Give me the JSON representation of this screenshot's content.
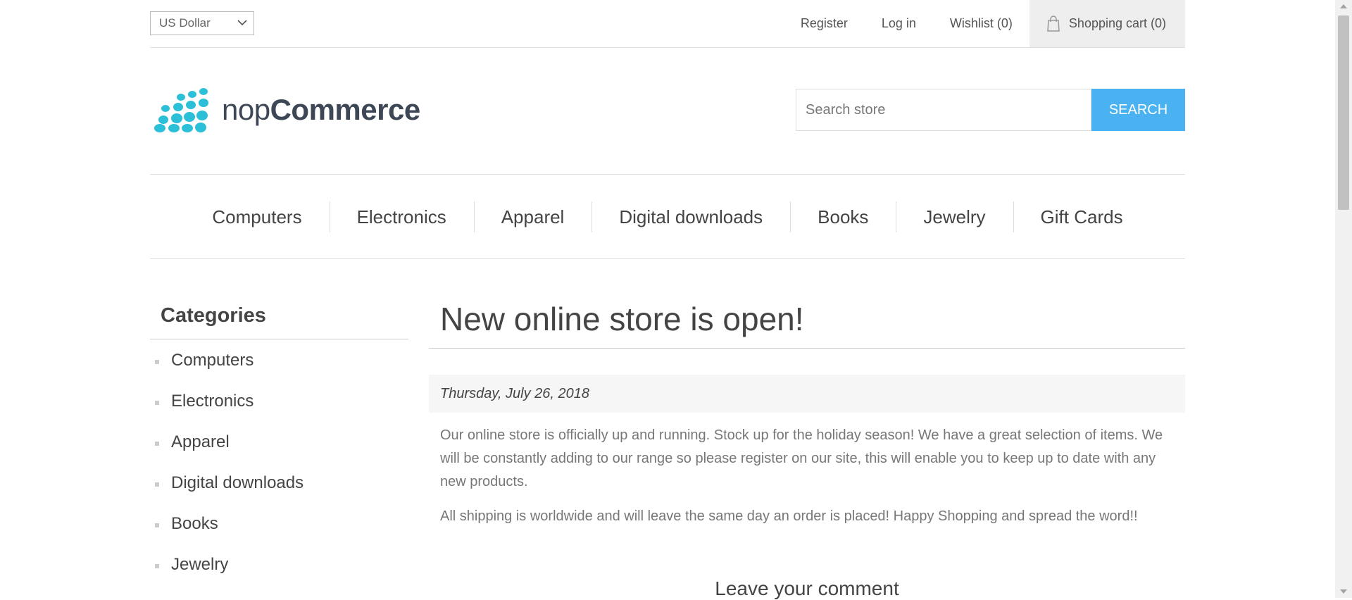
{
  "header": {
    "currency": {
      "selected": "US Dollar",
      "options": [
        "US Dollar"
      ]
    },
    "links": {
      "register": "Register",
      "login": "Log in",
      "wishlist": "Wishlist (0)",
      "cart": "Shopping cart (0)"
    }
  },
  "logo": {
    "light": "nop",
    "bold": "Commerce"
  },
  "search": {
    "placeholder": "Search store",
    "button": "Search"
  },
  "top_menu": [
    "Computers",
    "Electronics",
    "Apparel",
    "Digital downloads",
    "Books",
    "Jewelry",
    "Gift Cards"
  ],
  "sidebar": {
    "title": "Categories",
    "items": [
      "Computers",
      "Electronics",
      "Apparel",
      "Digital downloads",
      "Books",
      "Jewelry"
    ]
  },
  "news": {
    "title": "New online store is open!",
    "date": "Thursday, July 26, 2018",
    "paragraphs": [
      "Our online store is officially up and running. Stock up for the holiday season! We have a great selection of items. We will be constantly adding to our range so please register on our site, this will enable you to keep up to date with any new products.",
      "All shipping is worldwide and will leave the same day an order is placed! Happy Shopping and spread the word!!"
    ],
    "comment_heading": "Leave your comment"
  },
  "colors": {
    "accent": "#4ab2f1",
    "logo_dots": "#2bc0d8"
  }
}
